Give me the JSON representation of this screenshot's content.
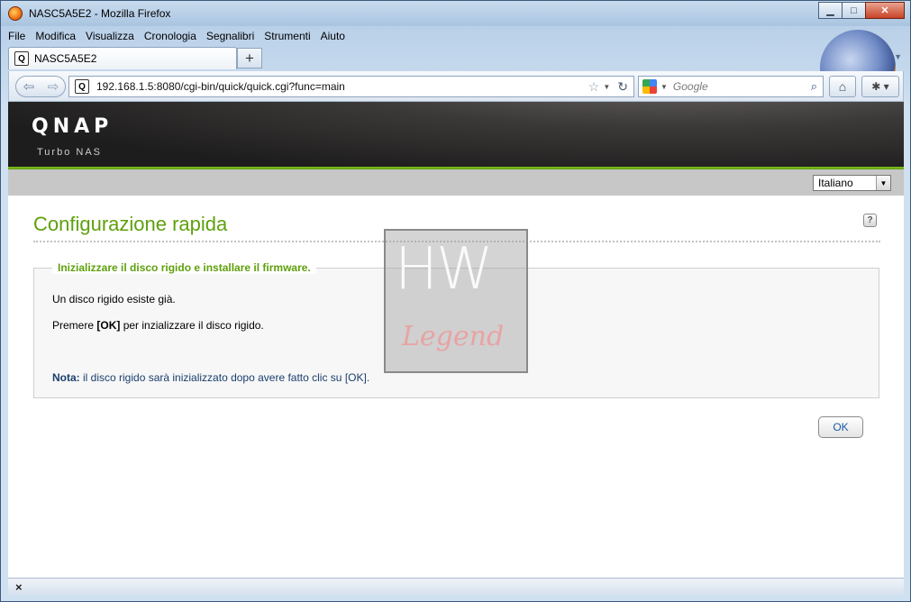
{
  "window": {
    "title": "NASC5A5E2 - Mozilla Firefox",
    "controls": {
      "minimize": "▁",
      "maximize": "□",
      "close": "✕"
    }
  },
  "menubar": [
    {
      "label": "File"
    },
    {
      "label": "Modifica"
    },
    {
      "label": "Visualizza"
    },
    {
      "label": "Cronologia"
    },
    {
      "label": "Segnalibri"
    },
    {
      "label": "Strumenti"
    },
    {
      "label": "Aiuto"
    }
  ],
  "tabs": [
    {
      "label": "NASC5A5E2",
      "icon": "qnap-favicon"
    }
  ],
  "newtab_label": "+",
  "nav": {
    "url": "192.168.1.5:8080/cgi-bin/quick/quick.cgi?func=main",
    "search_placeholder": "Google"
  },
  "page": {
    "logo": "QNAP",
    "logo_sub": "Turbo NAS",
    "language": "Italiano",
    "title": "Configurazione rapida",
    "help": "?",
    "panel": {
      "legend": "Inizializzare il disco rigido e installare il firmware.",
      "line1": "Un disco rigido esiste già.",
      "line2_pre": "Premere ",
      "line2_bold": "[OK]",
      "line2_post": " per inzializzare il disco rigido.",
      "note_label": "Nota:",
      "note_text": " il disco rigido sarà inizializzato dopo avere fatto clic su [OK]."
    },
    "ok_button": "OK",
    "watermark": {
      "top": "HW",
      "bottom": "Legend"
    }
  },
  "status": {
    "close": "×"
  },
  "colors": {
    "accent_green": "#5fa00d",
    "note_blue": "#1a3f6e",
    "ok_blue": "#1a5aa6"
  }
}
